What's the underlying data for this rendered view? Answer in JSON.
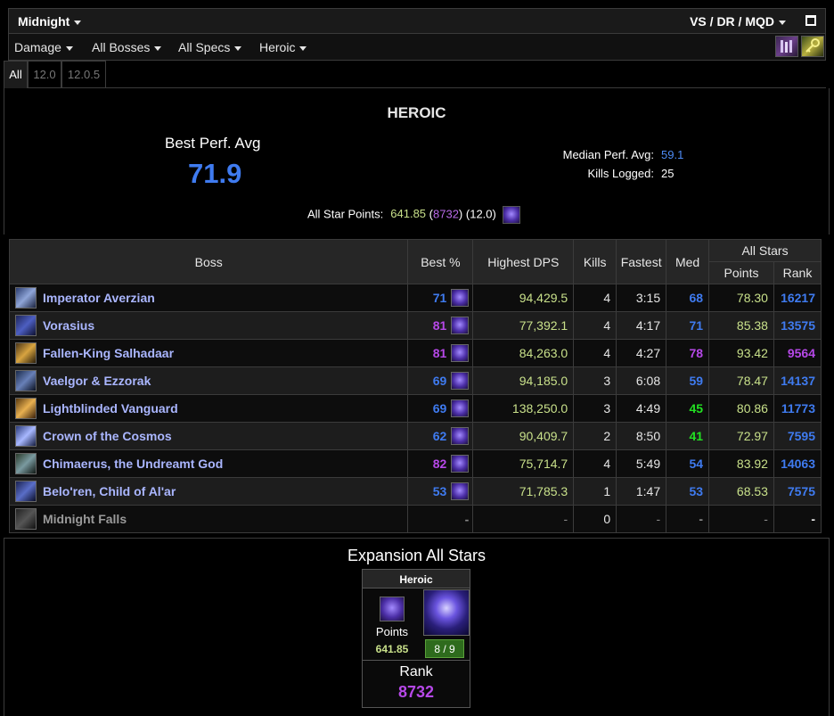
{
  "header": {
    "title": "Midnight",
    "metric_selector": "VS / DR / MQD",
    "maximize_icon": "maximize-icon"
  },
  "filters": [
    {
      "label": "Damage"
    },
    {
      "label": "All Bosses"
    },
    {
      "label": "All Specs"
    },
    {
      "label": "Heroic"
    }
  ],
  "filter_icons": [
    "guild-banner-icon",
    "key-icon"
  ],
  "tabs": [
    {
      "label": "All",
      "active": true
    },
    {
      "label": "12.0",
      "active": false
    },
    {
      "label": "12.0.5",
      "active": false
    }
  ],
  "summary": {
    "difficulty": "HEROIC",
    "best_perf_label": "Best Perf. Avg",
    "best_perf_value": "71.9",
    "median_label": "Median Perf. Avg:",
    "median_value": "59.1",
    "kills_label": "Kills Logged:",
    "kills_value": "25",
    "all_star_label": "All Star Points:",
    "all_star_points": "641.85",
    "all_star_rank": "8732",
    "all_star_patch": "(12.0)"
  },
  "table": {
    "headers": {
      "boss": "Boss",
      "best": "Best %",
      "dps": "Highest DPS",
      "kills": "Kills",
      "fastest": "Fastest",
      "med": "Med",
      "allstars": "All Stars",
      "points": "Points",
      "rank": "Rank"
    },
    "rows": [
      {
        "boss": "Imperator Averzian",
        "best": "71",
        "best_color": "#3f7bf0",
        "dps": "94,429.5",
        "kills": "4",
        "fastest": "3:15",
        "med": "68",
        "med_color": "#3f7bf0",
        "points": "78.30",
        "rank": "16217",
        "rank_color": "#3f7bf0"
      },
      {
        "boss": "Vorasius",
        "best": "81",
        "best_color": "#b648e8",
        "dps": "77,392.1",
        "kills": "4",
        "fastest": "4:17",
        "med": "71",
        "med_color": "#3f7bf0",
        "points": "85.38",
        "rank": "13575",
        "rank_color": "#3f7bf0"
      },
      {
        "boss": "Fallen-King Salhadaar",
        "best": "81",
        "best_color": "#b648e8",
        "dps": "84,263.0",
        "kills": "4",
        "fastest": "4:27",
        "med": "78",
        "med_color": "#b648e8",
        "points": "93.42",
        "rank": "9564",
        "rank_color": "#b648e8"
      },
      {
        "boss": "Vaelgor & Ezzorak",
        "best": "69",
        "best_color": "#3f7bf0",
        "dps": "94,185.0",
        "kills": "3",
        "fastest": "6:08",
        "med": "59",
        "med_color": "#3f7bf0",
        "points": "78.47",
        "rank": "14137",
        "rank_color": "#3f7bf0"
      },
      {
        "boss": "Lightblinded Vanguard",
        "best": "69",
        "best_color": "#3f7bf0",
        "dps": "138,250.0",
        "kills": "3",
        "fastest": "4:49",
        "med": "45",
        "med_color": "#22e022",
        "points": "80.86",
        "rank": "11773",
        "rank_color": "#3f7bf0"
      },
      {
        "boss": "Crown of the Cosmos",
        "best": "62",
        "best_color": "#3f7bf0",
        "dps": "90,409.7",
        "kills": "2",
        "fastest": "8:50",
        "med": "41",
        "med_color": "#22e022",
        "points": "72.97",
        "rank": "7595",
        "rank_color": "#3f7bf0"
      },
      {
        "boss": "Chimaerus, the Undreamt God",
        "best": "82",
        "best_color": "#b648e8",
        "dps": "75,714.7",
        "kills": "4",
        "fastest": "5:49",
        "med": "54",
        "med_color": "#3f7bf0",
        "points": "83.92",
        "rank": "14063",
        "rank_color": "#3f7bf0"
      },
      {
        "boss": "Belo'ren, Child of Al'ar",
        "best": "53",
        "best_color": "#3f7bf0",
        "dps": "71,785.3",
        "kills": "1",
        "fastest": "1:47",
        "med": "53",
        "med_color": "#3f7bf0",
        "points": "68.53",
        "rank": "7575",
        "rank_color": "#3f7bf0"
      },
      {
        "boss": "Midnight Falls",
        "best": "-",
        "best_color": "#888888",
        "dps": "-",
        "kills": "0",
        "fastest": "-",
        "med": "-",
        "med_color": "#888888",
        "points": "-",
        "rank": "-",
        "rank_color": "#e6e6e6",
        "unkilled": true
      }
    ]
  },
  "expansion": {
    "title": "Expansion All Stars",
    "difficulty": "Heroic",
    "points_label": "Points",
    "points_value": "641.85",
    "kills": "8 / 9",
    "rank_label": "Rank",
    "rank_value": "8732"
  },
  "colors": {
    "blue": "#3f7bf0",
    "purple": "#b648e8",
    "green": "#22e022",
    "points": "#c8e08a",
    "boss_name": "#aab6ff"
  }
}
